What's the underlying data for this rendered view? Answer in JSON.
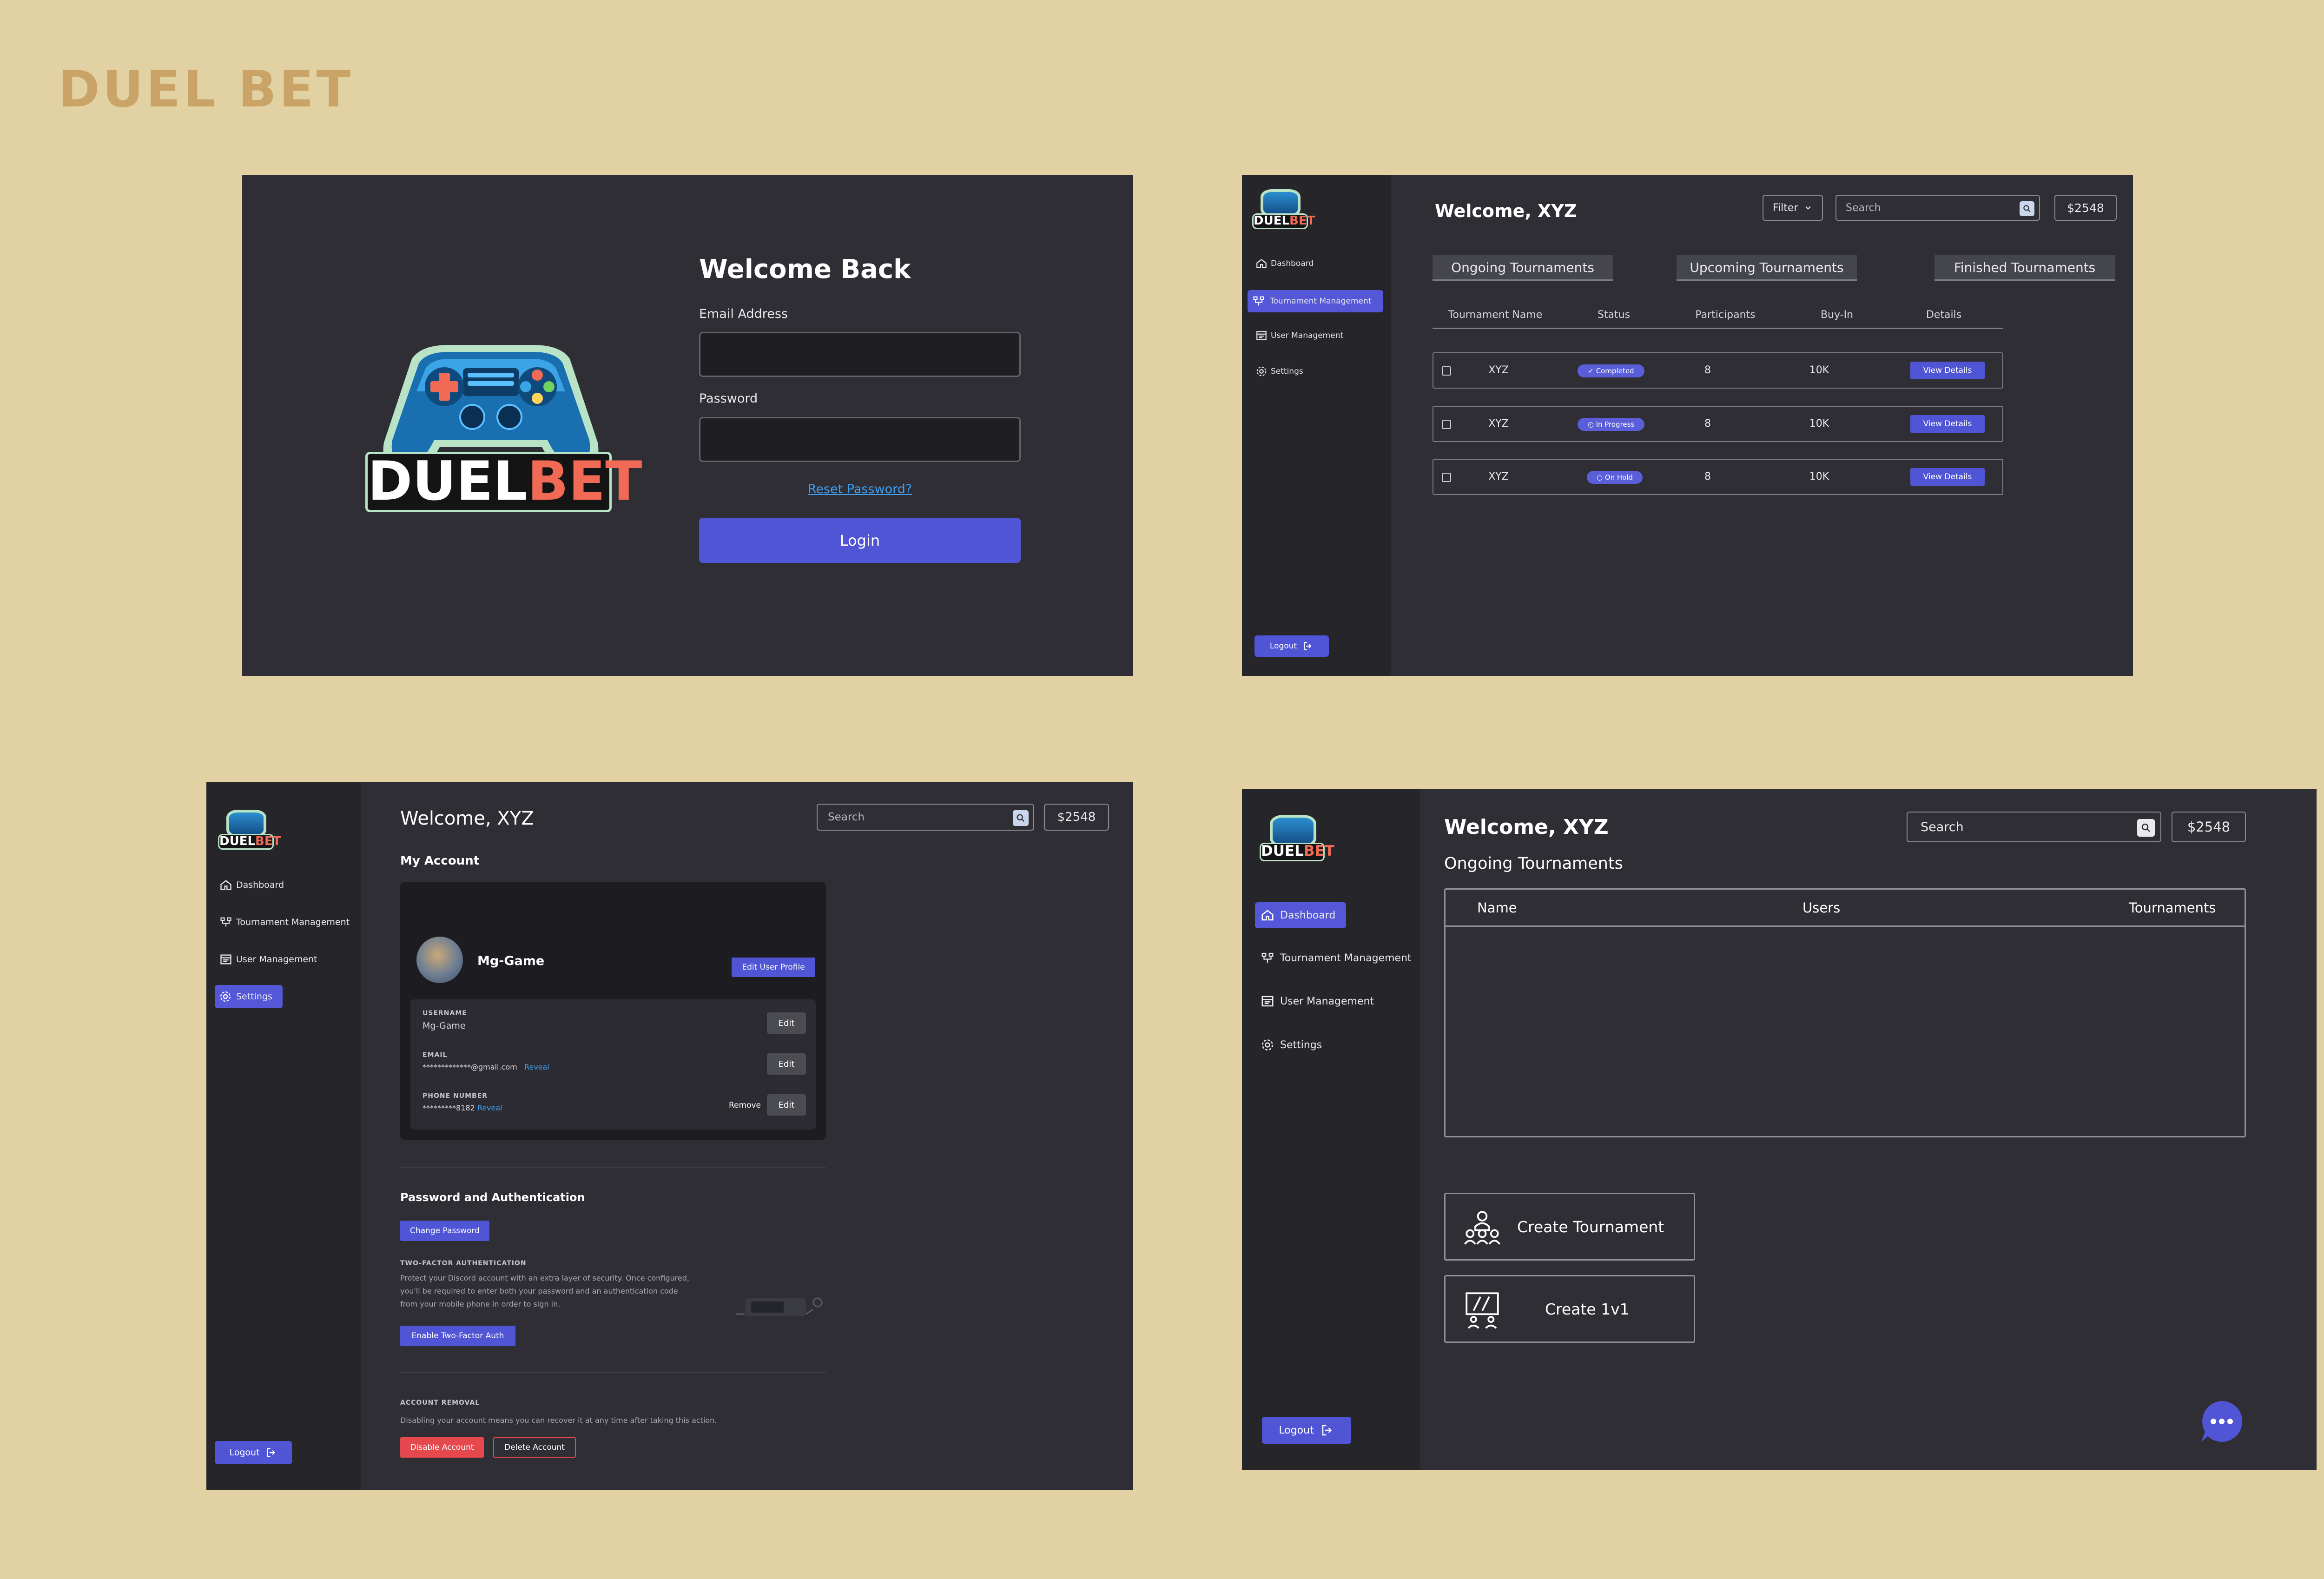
{
  "brand": "DUEL BET",
  "logo": {
    "word_a": "DUEL",
    "word_b": "BET"
  },
  "colors": {
    "background": "#e2d1a2",
    "panel": "#2e2e34",
    "sidebar": "#25252a",
    "accent": "#5055d6",
    "danger": "#e5484d",
    "link": "#3fa0f0",
    "logo_red": "#f06a55"
  },
  "login": {
    "title": "Welcome Back",
    "email_label": "Email Address",
    "email_value": "",
    "password_label": "Password",
    "password_value": "",
    "reset_link": "Reset Password?",
    "login_button": "Login"
  },
  "nav": {
    "dashboard": "Dashboard",
    "tournament_management": "Tournament Management",
    "user_management": "User Management",
    "settings": "Settings",
    "logout": "Logout",
    "icons": [
      "home-icon",
      "tournament-icon",
      "user-management-icon",
      "gear-icon",
      "logout-icon"
    ]
  },
  "header": {
    "welcome": "Welcome, XYZ",
    "filter": "Filter",
    "search_placeholder": "Search",
    "balance": "$2548"
  },
  "tournaments": {
    "tabs": [
      "Ongoing Tournaments",
      "Upcoming Tournaments",
      "Finished Tournaments"
    ],
    "columns": [
      "Tournament Name",
      "Status",
      "Participants",
      "Buy-In",
      "Details"
    ],
    "rows": [
      {
        "name": "XYZ",
        "status": "Completed",
        "participants": "8",
        "buyin": "10K",
        "details": "View Details"
      },
      {
        "name": "XYZ",
        "status": "In Progress",
        "participants": "8",
        "buyin": "10K",
        "details": "View Details"
      },
      {
        "name": "XYZ",
        "status": "On Hold",
        "participants": "8",
        "buyin": "10K",
        "details": "View Details"
      }
    ]
  },
  "account": {
    "section_title": "My Account",
    "username_display": "Mg-Game",
    "edit_profile": "Edit User Profile",
    "username_label": "USERNAME",
    "username_value": "Mg-Game",
    "email_label": "EMAIL",
    "email_value": "*************@gmail.com",
    "phone_label": "PHONE NUMBER",
    "phone_value": "*********8182",
    "reveal": "Reveal",
    "edit": "Edit",
    "remove": "Remove",
    "pw_section": "Password and Authentication",
    "change_password": "Change Password",
    "twofa_label": "TWO-FACTOR AUTHENTICATION",
    "twofa_text_1": "Protect your Discord account with an extra layer of security. Once configured,",
    "twofa_text_2": "you'll be required to enter both your password and an authentication code",
    "twofa_text_3": "from your mobile phone in order to sign in.",
    "enable_2fa": "Enable Two-Factor Auth",
    "removal_label": "ACCOUNT REMOVAL",
    "removal_text": "Disabling your account means you can recover it at any time after taking this action.",
    "disable_account": "Disable Account",
    "delete_account": "Delete Account"
  },
  "dashboard": {
    "section_title": "Ongoing Tournaments",
    "columns": [
      "Name",
      "Users",
      "Tournaments"
    ],
    "create_tournament": "Create Tournament",
    "create_1v1": "Create 1v1",
    "chat_icon": "chat-bubble-icon"
  }
}
